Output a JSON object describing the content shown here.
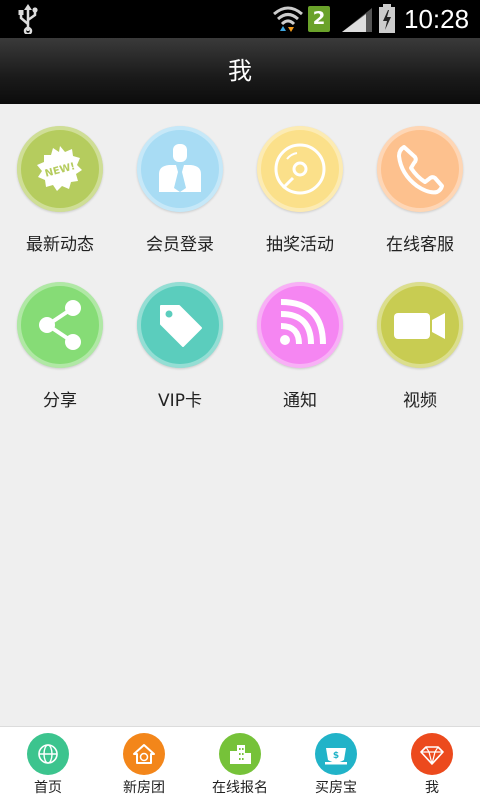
{
  "status_bar": {
    "time": "10:28",
    "sim_slot": "2"
  },
  "header": {
    "title": "我"
  },
  "grid": {
    "items": [
      {
        "label": "最新动态",
        "icon": "new-badge-icon",
        "color": "#b5cc5e"
      },
      {
        "label": "会员登录",
        "icon": "member-icon",
        "color": "#a8dcf4"
      },
      {
        "label": "抽奖活动",
        "icon": "disc-icon",
        "color": "#fbe08a"
      },
      {
        "label": "在线客服",
        "icon": "phone-icon",
        "color": "#fdc18e"
      },
      {
        "label": "分享",
        "icon": "share-icon",
        "color": "#86dc76"
      },
      {
        "label": "VIP卡",
        "icon": "tag-icon",
        "color": "#5bcdbd"
      },
      {
        "label": "通知",
        "icon": "rss-icon",
        "color": "#f586f2"
      },
      {
        "label": "视频",
        "icon": "video-icon",
        "color": "#c8cc52"
      }
    ]
  },
  "bottom_nav": {
    "items": [
      {
        "label": "首页",
        "icon": "globe-icon",
        "color": "#3cc48e"
      },
      {
        "label": "新房团",
        "icon": "house-icon",
        "color": "#f3861a"
      },
      {
        "label": "在线报名",
        "icon": "buildings-icon",
        "color": "#76c239"
      },
      {
        "label": "买房宝",
        "icon": "cup-money-icon",
        "color": "#21b3c8"
      },
      {
        "label": "我",
        "icon": "diamond-icon",
        "color": "#ec4a1d"
      }
    ]
  }
}
